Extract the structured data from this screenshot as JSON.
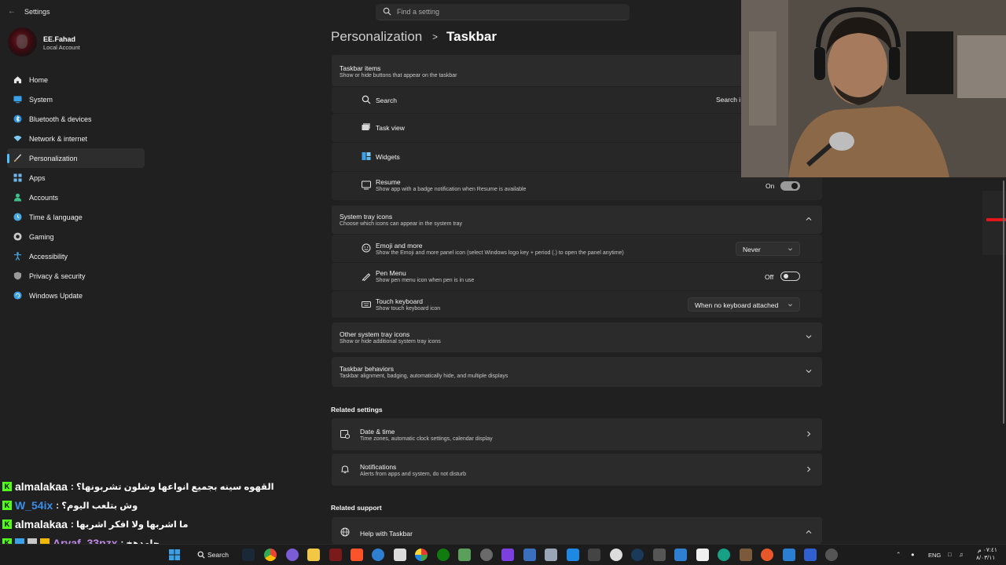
{
  "app": {
    "title": "Settings"
  },
  "search": {
    "placeholder": "Find a setting"
  },
  "user": {
    "name": "EE.Fahad",
    "account": "Local Account"
  },
  "sidebar": {
    "items": [
      {
        "label": "Home",
        "icon": "home-icon",
        "color": "#e8e8e8"
      },
      {
        "label": "System",
        "icon": "monitor-icon",
        "color": "#3aa0e8"
      },
      {
        "label": "Bluetooth & devices",
        "icon": "bluetooth-icon",
        "color": "#2f8fe0"
      },
      {
        "label": "Network & internet",
        "icon": "wifi-icon",
        "color": "#7ec8f0"
      },
      {
        "label": "Personalization",
        "icon": "brush-icon",
        "color": "#e8a86a",
        "selected": true
      },
      {
        "label": "Apps",
        "icon": "apps-icon",
        "color": "#6fb7e8"
      },
      {
        "label": "Accounts",
        "icon": "person-icon",
        "color": "#3fbf8a"
      },
      {
        "label": "Time & language",
        "icon": "globe-clock-icon",
        "color": "#4aa8e0"
      },
      {
        "label": "Gaming",
        "icon": "gamepad-icon",
        "color": "#c9c9c9"
      },
      {
        "label": "Accessibility",
        "icon": "accessibility-icon",
        "color": "#4aa8e0"
      },
      {
        "label": "Privacy & security",
        "icon": "shield-icon",
        "color": "#9a9a9a"
      },
      {
        "label": "Windows Update",
        "icon": "refresh-icon",
        "color": "#3aa0e8"
      }
    ]
  },
  "breadcrumb": {
    "parent": "Personalization",
    "separator": ">",
    "current": "Taskbar"
  },
  "taskbar_items": {
    "title": "Taskbar items",
    "description": "Show or hide buttons that appear on the taskbar",
    "search_label": "Search",
    "search_value": "Search i",
    "taskview_label": "Task view",
    "widgets_label": "Widgets",
    "resume_label": "Resume",
    "resume_desc": "Show app with a badge notification when Resume is available",
    "resume_state": "On"
  },
  "system_tray": {
    "title": "System tray icons",
    "description": "Choose which icons can appear in the system tray",
    "emoji_label": "Emoji and more",
    "emoji_desc": "Show the Emoji and more panel icon (select Windows logo key + period (.) to open the panel anytime)",
    "emoji_value": "Never",
    "pen_label": "Pen Menu",
    "pen_desc": "Show pen menu icon when pen is in use",
    "pen_state": "Off",
    "touch_label": "Touch keyboard",
    "touch_desc": "Show touch keyboard icon",
    "touch_value": "When no keyboard attached"
  },
  "other_tray": {
    "title": "Other system tray icons",
    "description": "Show or hide additional system tray icons"
  },
  "behaviors": {
    "title": "Taskbar behaviors",
    "description": "Taskbar alignment, badging, automatically hide, and multiple displays"
  },
  "related_settings": {
    "heading": "Related settings",
    "date_label": "Date & time",
    "date_desc": "Time zones, automatic clock settings, calendar display",
    "notif_label": "Notifications",
    "notif_desc": "Alerts from apps and system, do not disturb"
  },
  "related_support": {
    "heading": "Related support",
    "help_label": "Help with Taskbar"
  },
  "chat": [
    {
      "user": "almalakaa",
      "user_color": "#ffffff",
      "message": ": القهوه سينه بجميع انواعها وشلون تشربونها؟"
    },
    {
      "user": "W_54ix",
      "user_color": "#3b8ee8",
      "message": ": وش بتلعب اليوم؟"
    },
    {
      "user": "almalakaa",
      "user_color": "#ffffff",
      "message": ": ما اشربها ولا افكر اشربها"
    },
    {
      "user": "Aryaf_33pzx",
      "user_color": "#c08ae8",
      "message": ": جامدهخ"
    }
  ],
  "taskbar": {
    "search_label": "Search",
    "tray_lang": "ENG",
    "clock_time": "٠٧:٤١ م",
    "clock_date": "٨/٠٣/١١"
  }
}
